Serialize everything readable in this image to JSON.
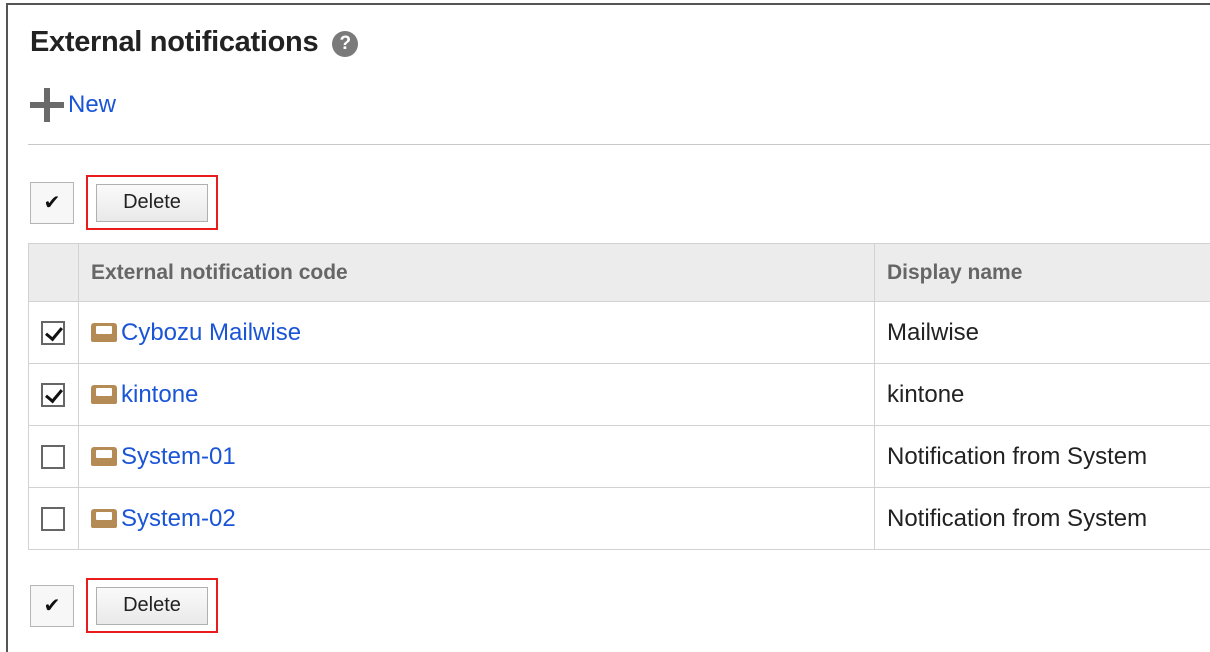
{
  "page": {
    "title": "External notifications",
    "help_icon": "?"
  },
  "actions": {
    "new_label": "New"
  },
  "toolbar": {
    "check_all_glyph": "✔",
    "delete_label": "Delete"
  },
  "table": {
    "headers": [
      "External notification code",
      "Display name"
    ],
    "rows": [
      {
        "checked": true,
        "code": "Cybozu Mailwise",
        "display_name": "Mailwise"
      },
      {
        "checked": true,
        "code": "kintone",
        "display_name": "kintone"
      },
      {
        "checked": false,
        "code": "System-01",
        "display_name": "Notification from System"
      },
      {
        "checked": false,
        "code": "System-02",
        "display_name": "Notification from System"
      }
    ]
  },
  "colors": {
    "link": "#1a55d6",
    "highlight": "#e81c1c",
    "icon": "#b48a55"
  }
}
